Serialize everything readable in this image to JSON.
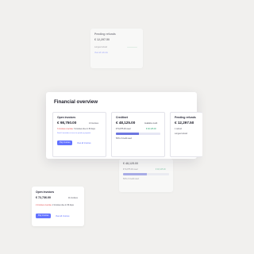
{
  "background_color": "#f1f0ee",
  "accent_color": "#6373ff",
  "overview": {
    "title": "Financial overview",
    "open_invoices": {
      "label": "Open invoices",
      "amount": "€ 98,750.00",
      "count": "13 invoices",
      "overdue": "3 invoices overdue",
      "due": "3 invoices due in 30 days",
      "note": "Send 4 reminders at once to speed up payment",
      "pay_label": "Pay invoices",
      "view_label": "View all invoices"
    },
    "credit": {
      "label": "Creditnet",
      "amount": "€ 48,125.00",
      "available_label": "Available credit",
      "used": "€ 51,875.00 used",
      "available_amount": "€ 48,125.00",
      "used_fraction": 0.52,
      "percent_text": "52% of credit used"
    },
    "pending": {
      "label": "Pending refunds",
      "amount": "€ 12,297.50",
      "sub": "1 refund",
      "sub2": "Longest refund"
    }
  },
  "bg_top": {
    "label": "Pending refunds",
    "amount": "€ 12,297.50",
    "sub": "Longest refund",
    "link": "View all refunds"
  },
  "bg_mid": {
    "amount": "€ 48,125.00",
    "used": "€ 51,875.00 used",
    "available": "€ 48,125.00",
    "percent_text": "52% of credit used",
    "used_fraction": 0.52
  },
  "bg_bottom": {
    "label": "Open invoices",
    "amount": "€ 72,736.00",
    "count": "11 invoices",
    "overdue": "2 invoices overdue",
    "due": "2 invoices due in 30 days",
    "pay_label": "Pay invoices",
    "view_label": "View all invoices"
  }
}
